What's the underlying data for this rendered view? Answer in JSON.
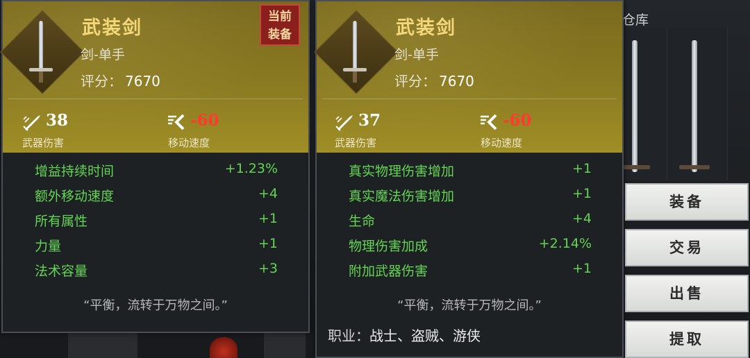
{
  "storage_tab": "仓库",
  "current_equipped": {
    "badge": "当前\n装备",
    "badge_line1": "当前",
    "badge_line2": "装备",
    "name": "武装剑",
    "type": "剑-单手",
    "score_label": "评分：",
    "score": "7670",
    "weapon_damage": {
      "value": "38",
      "label": "武器伤害"
    },
    "move_speed": {
      "value": "-60",
      "label": "移动速度"
    },
    "attributes": [
      {
        "name": "增益持续时间",
        "value": "+1.23%"
      },
      {
        "name": "额外移动速度",
        "value": "+4"
      },
      {
        "name": "所有属性",
        "value": "+1"
      },
      {
        "name": "力量",
        "value": "+1"
      },
      {
        "name": "法术容量",
        "value": "+3"
      }
    ],
    "flavor": "“平衡，流转于万物之间。”"
  },
  "compared_item": {
    "name": "武装剑",
    "type": "剑-单手",
    "score_label": "评分：",
    "score": "7670",
    "weapon_damage": {
      "value": "37",
      "label": "武器伤害"
    },
    "move_speed": {
      "value": "-60",
      "label": "移动速度"
    },
    "attributes": [
      {
        "name": "真实物理伤害增加",
        "value": "+1"
      },
      {
        "name": "真实魔法伤害增加",
        "value": "+1"
      },
      {
        "name": "生命",
        "value": "+4"
      },
      {
        "name": "物理伤害加成",
        "value": "+2.14%"
      },
      {
        "name": "附加武器伤害",
        "value": "+1"
      }
    ],
    "flavor": "“平衡，流转于万物之间。”",
    "class_label": "职业：",
    "classes": "战士、盗贼、游侠"
  },
  "actions": {
    "equip": "装备",
    "trade": "交易",
    "sell": "出售",
    "withdraw": "提取"
  },
  "colors": {
    "header_gold": "#8a7a22",
    "name_gold": "#f3d77a",
    "attr_green": "#63d453",
    "penalty_red": "#ff3b2f"
  }
}
